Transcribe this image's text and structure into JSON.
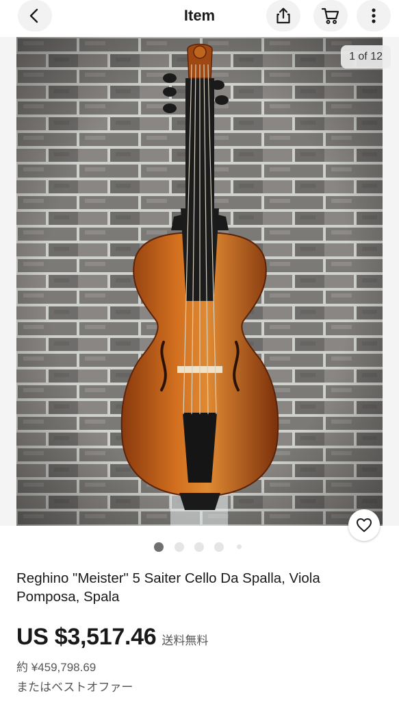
{
  "header": {
    "title": "Item",
    "icons": {
      "back": "back-arrow-icon",
      "share": "share-icon",
      "cart": "cart-icon",
      "more": "more-vertical-icon"
    }
  },
  "gallery": {
    "counter": "1 of 12",
    "image_subject": "violin-on-brick-wall",
    "dots_count": 5,
    "active_dot": 0,
    "watch_icon": "heart-icon"
  },
  "listing": {
    "title": "Reghino \"Meister\" 5 Saiter Cello Da Spalla, Viola Pomposa, Spala",
    "price": "US $3,517.46",
    "shipping": "送料無料",
    "converted_price": "約 ¥459,798.69",
    "best_offer": "またはベストオファー"
  },
  "colors": {
    "text": "#191919",
    "secondary": "#555555",
    "button_bg": "#f2f2f2",
    "dot_active": "#707070",
    "dot_inactive": "#e5e5e5"
  }
}
